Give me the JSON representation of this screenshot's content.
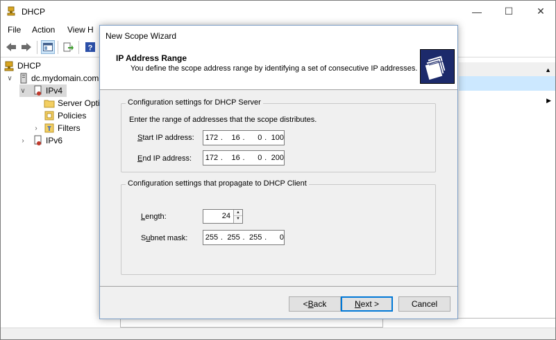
{
  "main_window": {
    "title": "DHCP",
    "menu": [
      "File",
      "Action",
      "View",
      "H"
    ],
    "tree": {
      "root": "DHCP",
      "server": "dc.mydomain.com",
      "ipv4": "IPv4",
      "server_options": "Server Optio",
      "policies": "Policies",
      "filters": "Filters",
      "ipv6": "IPv6"
    }
  },
  "wizard": {
    "title": "New Scope Wizard",
    "header_title": "IP Address Range",
    "header_subtitle": "You define the scope address range by identifying a set of consecutive IP addresses.",
    "server_group": {
      "legend": "Configuration settings for DHCP Server",
      "instruction": "Enter the range of addresses that the scope distributes.",
      "start_label_u": "S",
      "start_label_rest": "tart IP address:",
      "start_ip": [
        "172",
        "16",
        "0",
        "100"
      ],
      "end_label_u": "E",
      "end_label_rest": "nd IP address:",
      "end_ip": [
        "172",
        "16",
        "0",
        "200"
      ]
    },
    "client_group": {
      "legend": "Configuration settings that propagate to DHCP Client",
      "length_label_u": "L",
      "length_label_rest": "ength:",
      "length_value": "24",
      "subnet_label_start": "S",
      "subnet_label_u": "u",
      "subnet_label_rest": "bnet mask:",
      "subnet_mask": [
        "255",
        "255",
        "255",
        "0"
      ]
    },
    "buttons": {
      "back_prefix": "< ",
      "back_u": "B",
      "back_rest": "ack",
      "next_u": "N",
      "next_rest": "ext >",
      "cancel": "Cancel"
    }
  },
  "colors": {
    "selection": "#cce8ff",
    "header_icon_bg": "#1c2a6b",
    "default_button_border": "#0078d7"
  }
}
